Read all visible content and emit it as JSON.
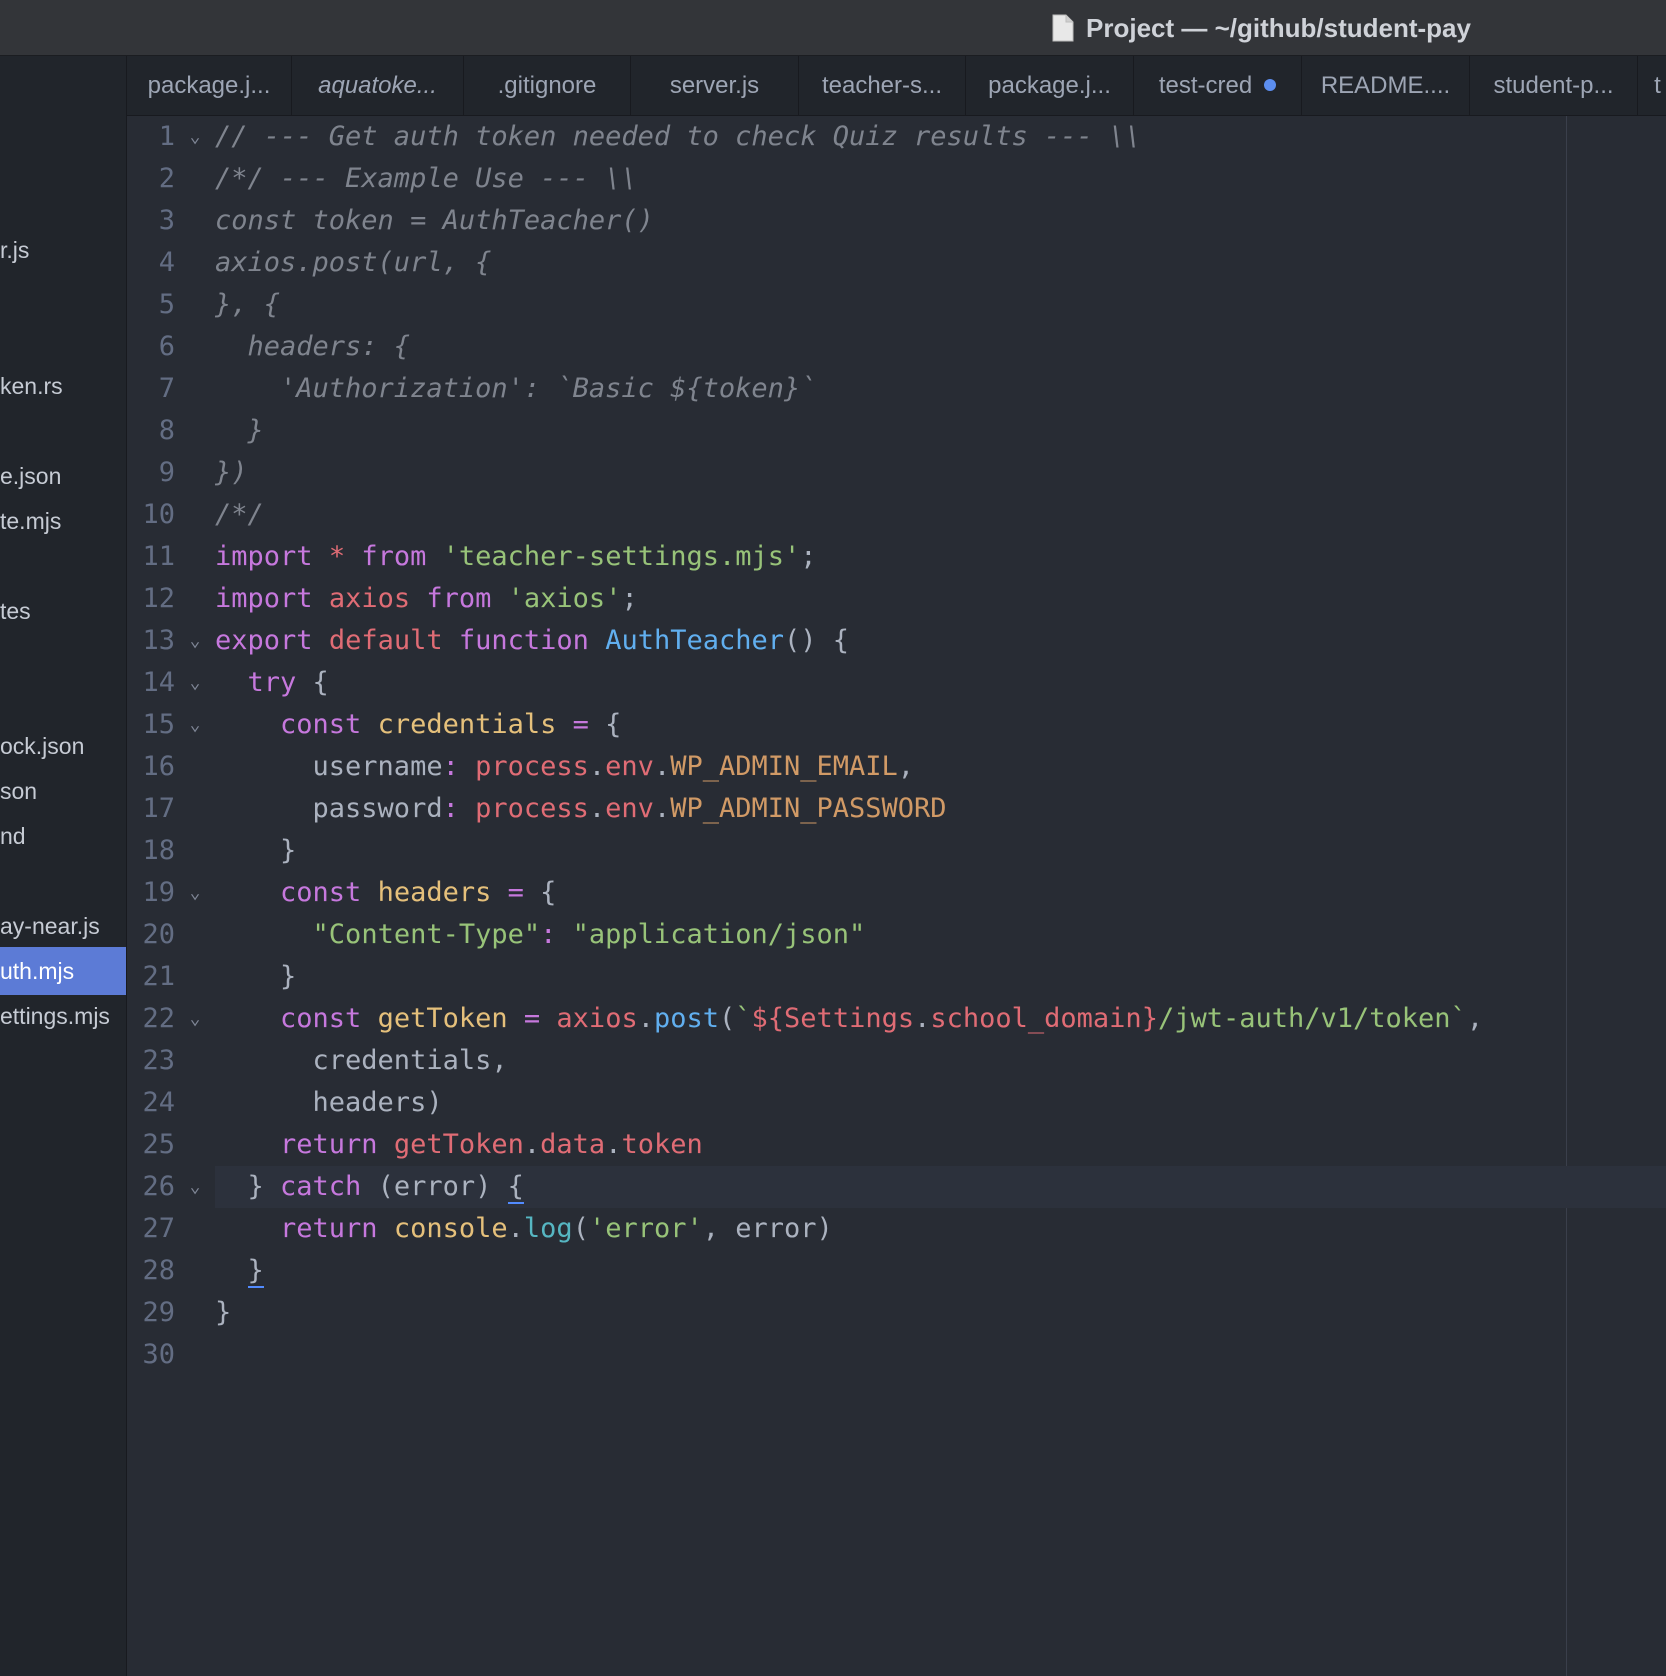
{
  "window": {
    "title": "Project — ~/github/student-pay",
    "title_icon": "document-icon"
  },
  "sidebar": {
    "items": [
      {
        "label": "r.js",
        "selected": false
      },
      {
        "label": "ken.rs",
        "selected": false
      },
      {
        "label": "e.json",
        "selected": false
      },
      {
        "label": "te.mjs",
        "selected": false
      },
      {
        "label": "tes",
        "selected": false
      },
      {
        "label": "ock.json",
        "selected": false
      },
      {
        "label": "son",
        "selected": false
      },
      {
        "label": "nd",
        "selected": false
      },
      {
        "label": "ay-near.js",
        "selected": false
      },
      {
        "label": "uth.mjs",
        "selected": true
      },
      {
        "label": "ettings.mjs",
        "selected": false
      }
    ],
    "selected_color": "#5c7bd6"
  },
  "tabs": [
    {
      "label": "package.j...",
      "italic": false,
      "modified": false
    },
    {
      "label": "aquatoke...",
      "italic": true,
      "modified": false
    },
    {
      "label": ".gitignore",
      "italic": false,
      "modified": false
    },
    {
      "label": "server.js",
      "italic": false,
      "modified": false
    },
    {
      "label": "teacher-s...",
      "italic": false,
      "modified": false
    },
    {
      "label": "package.j...",
      "italic": false,
      "modified": false
    },
    {
      "label": "test-cred",
      "italic": false,
      "modified": true
    },
    {
      "label": "README....",
      "italic": false,
      "modified": false
    },
    {
      "label": "student-p...",
      "italic": false,
      "modified": false
    },
    {
      "label": "t",
      "italic": false,
      "modified": false
    }
  ],
  "editor": {
    "cursor_line": 26,
    "lines": [
      {
        "num": "1",
        "fold": true,
        "tokens": [
          [
            "comment",
            "// --- Get auth token needed to check Quiz results --- \\\\"
          ]
        ]
      },
      {
        "num": "2",
        "fold": false,
        "tokens": [
          [
            "comment",
            "/*/ --- Example Use --- \\\\"
          ]
        ]
      },
      {
        "num": "3",
        "fold": false,
        "tokens": [
          [
            "comment",
            "const token = AuthTeacher()"
          ]
        ]
      },
      {
        "num": "4",
        "fold": false,
        "tokens": [
          [
            "comment",
            "axios.post(url, {"
          ]
        ]
      },
      {
        "num": "5",
        "fold": false,
        "tokens": [
          [
            "comment",
            "}, {"
          ]
        ]
      },
      {
        "num": "6",
        "fold": false,
        "tokens": [
          [
            "comment",
            "  headers: {"
          ]
        ]
      },
      {
        "num": "7",
        "fold": false,
        "tokens": [
          [
            "comment",
            "    'Authorization': `Basic ${token}`"
          ]
        ]
      },
      {
        "num": "8",
        "fold": false,
        "tokens": [
          [
            "comment",
            "  }"
          ]
        ]
      },
      {
        "num": "9",
        "fold": false,
        "tokens": [
          [
            "comment",
            "})"
          ]
        ]
      },
      {
        "num": "10",
        "fold": false,
        "tokens": [
          [
            "comment",
            "/*/"
          ]
        ]
      },
      {
        "num": "11",
        "fold": false,
        "tokens": [
          [
            "kw",
            "import"
          ],
          [
            "plain",
            " "
          ],
          [
            "ident",
            "*"
          ],
          [
            "plain",
            " "
          ],
          [
            "kw",
            "from"
          ],
          [
            "plain",
            " "
          ],
          [
            "str",
            "'teacher-settings.mjs'"
          ],
          [
            "plain",
            ";"
          ]
        ]
      },
      {
        "num": "12",
        "fold": false,
        "tokens": [
          [
            "kw",
            "import"
          ],
          [
            "plain",
            " "
          ],
          [
            "ident",
            "axios"
          ],
          [
            "plain",
            " "
          ],
          [
            "kw",
            "from"
          ],
          [
            "plain",
            " "
          ],
          [
            "str",
            "'axios'"
          ],
          [
            "plain",
            ";"
          ]
        ]
      },
      {
        "num": "13",
        "fold": true,
        "tokens": [
          [
            "kw",
            "export"
          ],
          [
            "plain",
            " "
          ],
          [
            "ident",
            "default"
          ],
          [
            "plain",
            " "
          ],
          [
            "kw",
            "function"
          ],
          [
            "plain",
            " "
          ],
          [
            "fn",
            "AuthTeacher"
          ],
          [
            "plain",
            "() {"
          ]
        ]
      },
      {
        "num": "14",
        "fold": true,
        "tokens": [
          [
            "plain",
            "  "
          ],
          [
            "kw",
            "try"
          ],
          [
            "plain",
            " {"
          ]
        ]
      },
      {
        "num": "15",
        "fold": true,
        "tokens": [
          [
            "plain",
            "    "
          ],
          [
            "kw",
            "const"
          ],
          [
            "plain",
            " "
          ],
          [
            "var",
            "credentials"
          ],
          [
            "plain",
            " "
          ],
          [
            "kw",
            "="
          ],
          [
            "plain",
            " {"
          ]
        ]
      },
      {
        "num": "16",
        "fold": false,
        "tokens": [
          [
            "plain",
            "      username"
          ],
          [
            "kw",
            ":"
          ],
          [
            "plain",
            " "
          ],
          [
            "ident",
            "process"
          ],
          [
            "plain",
            "."
          ],
          [
            "ident",
            "env"
          ],
          [
            "plain",
            "."
          ],
          [
            "const",
            "WP_ADMIN_EMAIL"
          ],
          [
            "plain",
            ","
          ]
        ]
      },
      {
        "num": "17",
        "fold": false,
        "tokens": [
          [
            "plain",
            "      password"
          ],
          [
            "kw",
            ":"
          ],
          [
            "plain",
            " "
          ],
          [
            "ident",
            "process"
          ],
          [
            "plain",
            "."
          ],
          [
            "ident",
            "env"
          ],
          [
            "plain",
            "."
          ],
          [
            "const",
            "WP_ADMIN_PASSWORD"
          ]
        ]
      },
      {
        "num": "18",
        "fold": false,
        "tokens": [
          [
            "plain",
            "    }"
          ]
        ]
      },
      {
        "num": "19",
        "fold": true,
        "tokens": [
          [
            "plain",
            "    "
          ],
          [
            "kw",
            "const"
          ],
          [
            "plain",
            " "
          ],
          [
            "var",
            "headers"
          ],
          [
            "plain",
            " "
          ],
          [
            "kw",
            "="
          ],
          [
            "plain",
            " {"
          ]
        ]
      },
      {
        "num": "20",
        "fold": false,
        "tokens": [
          [
            "plain",
            "      "
          ],
          [
            "str",
            "\"Content-Type\""
          ],
          [
            "kw",
            ":"
          ],
          [
            "plain",
            " "
          ],
          [
            "str",
            "\"application/json\""
          ]
        ]
      },
      {
        "num": "21",
        "fold": false,
        "tokens": [
          [
            "plain",
            "    }"
          ]
        ]
      },
      {
        "num": "22",
        "fold": true,
        "tokens": [
          [
            "plain",
            "    "
          ],
          [
            "kw",
            "const"
          ],
          [
            "plain",
            " "
          ],
          [
            "var",
            "getToken"
          ],
          [
            "plain",
            " "
          ],
          [
            "kw",
            "="
          ],
          [
            "plain",
            " "
          ],
          [
            "ident",
            "axios"
          ],
          [
            "plain",
            "."
          ],
          [
            "fn",
            "post"
          ],
          [
            "plain",
            "("
          ],
          [
            "str",
            "`"
          ],
          [
            "ident",
            "${"
          ],
          [
            "ident",
            "Settings"
          ],
          [
            "plain",
            "."
          ],
          [
            "ident",
            "school_domain"
          ],
          [
            "ident",
            "}"
          ],
          [
            "str",
            "/jwt-auth/v1/token`"
          ],
          [
            "plain",
            ","
          ]
        ]
      },
      {
        "num": "23",
        "fold": false,
        "tokens": [
          [
            "plain",
            "      credentials,"
          ]
        ]
      },
      {
        "num": "24",
        "fold": false,
        "tokens": [
          [
            "plain",
            "      headers)"
          ]
        ]
      },
      {
        "num": "25",
        "fold": false,
        "tokens": [
          [
            "plain",
            "    "
          ],
          [
            "kw",
            "return"
          ],
          [
            "plain",
            " "
          ],
          [
            "ident",
            "getToken"
          ],
          [
            "plain",
            "."
          ],
          [
            "ident",
            "data"
          ],
          [
            "plain",
            "."
          ],
          [
            "ident",
            "token"
          ]
        ]
      },
      {
        "num": "26",
        "fold": true,
        "tokens": [
          [
            "plain",
            "  } "
          ],
          [
            "kw",
            "catch"
          ],
          [
            "plain",
            " (error) "
          ],
          [
            "bracket",
            "{"
          ]
        ]
      },
      {
        "num": "27",
        "fold": false,
        "tokens": [
          [
            "plain",
            "    "
          ],
          [
            "kw",
            "return"
          ],
          [
            "plain",
            " "
          ],
          [
            "var",
            "console"
          ],
          [
            "plain",
            "."
          ],
          [
            "op",
            "log"
          ],
          [
            "plain",
            "("
          ],
          [
            "str",
            "'error'"
          ],
          [
            "plain",
            ", error)"
          ]
        ]
      },
      {
        "num": "28",
        "fold": false,
        "tokens": [
          [
            "plain",
            "  "
          ],
          [
            "bracket",
            "}"
          ]
        ]
      },
      {
        "num": "29",
        "fold": false,
        "tokens": [
          [
            "plain",
            "}"
          ]
        ]
      },
      {
        "num": "30",
        "fold": false,
        "tokens": [
          [
            "plain",
            ""
          ]
        ]
      }
    ]
  },
  "colors": {
    "background": "#282c34",
    "comment": "#7f848e",
    "keyword": "#c678dd",
    "string": "#98c379",
    "function": "#61afef",
    "variable": "#e5c07b",
    "identifier": "#e06c75",
    "constant": "#d19a66",
    "modified_dot": "#5c8ef0"
  }
}
